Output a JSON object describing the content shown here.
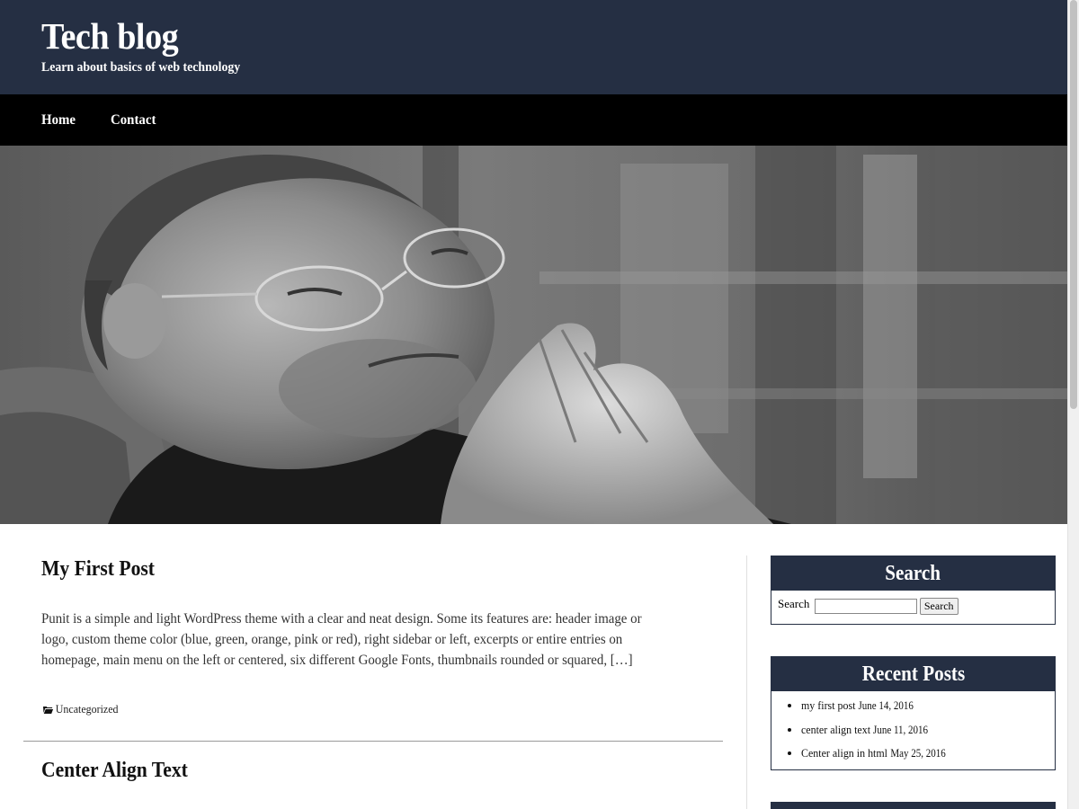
{
  "header": {
    "title": "Tech blog",
    "tagline": "Learn about basics of web technology",
    "background_color": "#252f43"
  },
  "nav": {
    "items": [
      {
        "label": "Home"
      },
      {
        "label": "Contact"
      }
    ]
  },
  "hero": {
    "icon": "photo-of-man-with-glasses"
  },
  "posts": [
    {
      "title": "My First Post",
      "excerpt": "Punit is a simple and light WordPress theme with a clear and neat design. Some its features are: header image or logo, custom theme color (blue, green, orange, pink or red), right sidebar or left, excerpts or entire entries on homepage, main menu on the left or centered, six different Google Fonts, thumbnails rounded or squared, […]",
      "category": "Uncategorized",
      "category_icon": "folder-icon"
    },
    {
      "title": "Center Align Text"
    }
  ],
  "sidebar": {
    "search_widget": {
      "title": "Search",
      "label": "Search",
      "input_value": "",
      "button_label": "Search"
    },
    "recent_posts_widget": {
      "title": "Recent Posts",
      "items": [
        {
          "title": "my first post",
          "date": "June 14, 2016"
        },
        {
          "title": "center align text",
          "date": "June 11, 2016"
        },
        {
          "title": "Center align in html",
          "date": "May 25, 2016"
        }
      ]
    }
  }
}
